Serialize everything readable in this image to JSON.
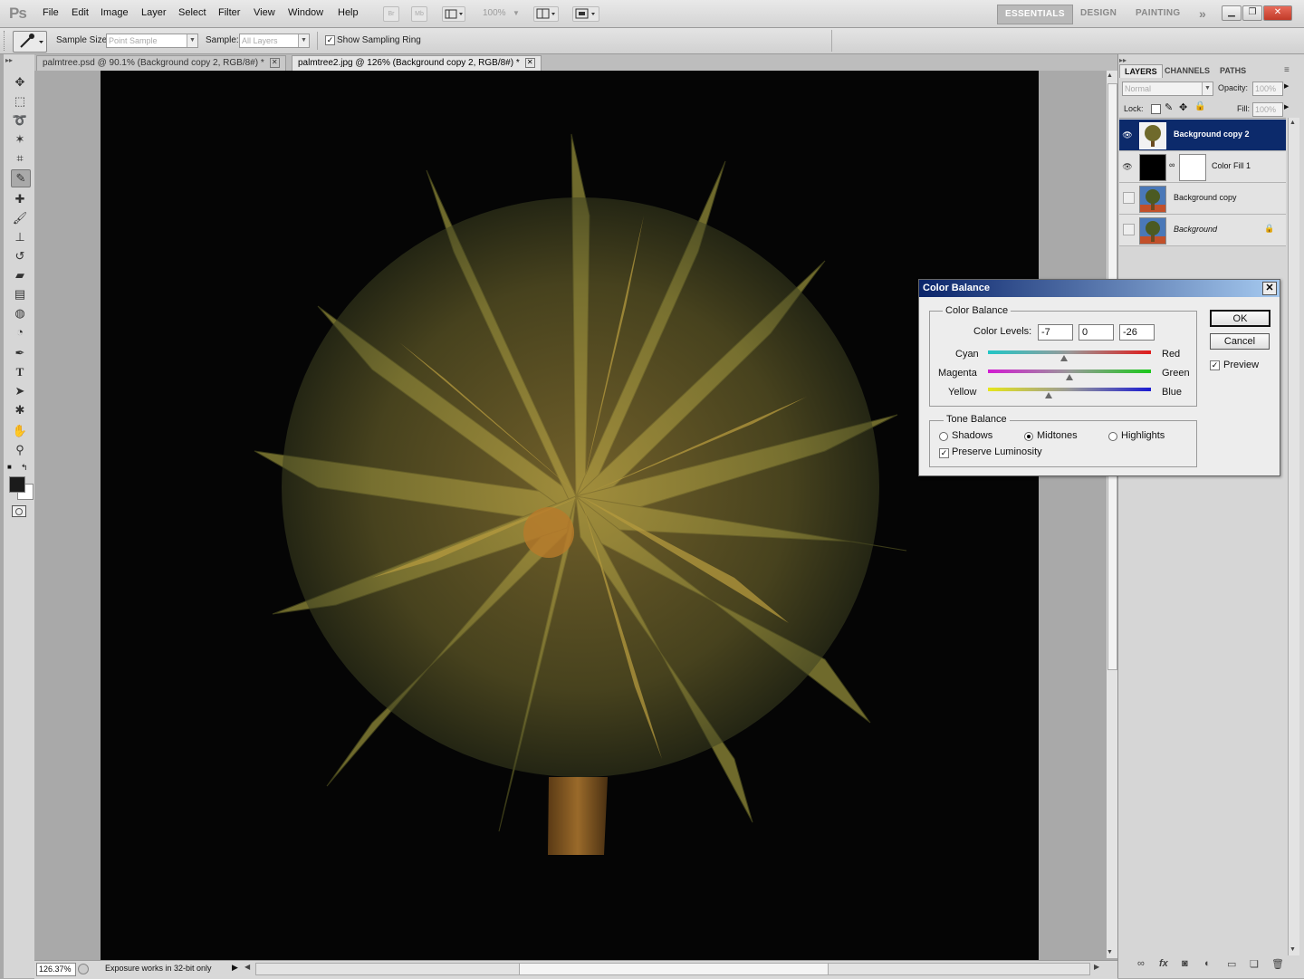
{
  "app": {
    "logo": "Ps"
  },
  "menu": [
    "File",
    "Edit",
    "Image",
    "Layer",
    "Select",
    "Filter",
    "View",
    "Window",
    "Help"
  ],
  "menubar": {
    "bridge_label": "Br",
    "minibridge_label": "Mb",
    "zoom": "100%"
  },
  "workspaces": {
    "essentials": "ESSENTIALS",
    "design": "DESIGN",
    "painting": "PAINTING",
    "more": "»"
  },
  "options": {
    "sample_size_label": "Sample Size:",
    "sample_size_value": "Point Sample",
    "sample_label": "Sample:",
    "sample_value": "All Layers",
    "show_ring_label": "Show Sampling Ring"
  },
  "tabs": [
    {
      "label": "palmtree.psd @ 90.1% (Background copy 2, RGB/8#) *"
    },
    {
      "label": "palmtree2.jpg @ 126% (Background copy 2, RGB/8#) *"
    }
  ],
  "status": {
    "zoom": "126.37%",
    "message": "Exposure works in 32-bit only"
  },
  "panels": {
    "tabs": [
      "LAYERS",
      "CHANNELS",
      "PATHS"
    ],
    "blend_mode": "Normal",
    "opacity_label": "Opacity:",
    "opacity_value": "100%",
    "lock_label": "Lock:",
    "fill_label": "Fill:",
    "fill_value": "100%",
    "layers": [
      {
        "name": "Background copy 2",
        "visible": true,
        "selected": true
      },
      {
        "name": "Color Fill 1",
        "visible": true,
        "selected": false
      },
      {
        "name": "Background copy",
        "visible": false,
        "selected": false
      },
      {
        "name": "Background",
        "visible": false,
        "selected": false,
        "locked": true
      }
    ]
  },
  "dialog": {
    "title": "Color Balance",
    "group_label": "Color Balance",
    "levels_label": "Color Levels:",
    "levels": [
      "-7",
      "0",
      "-26"
    ],
    "sliders": [
      {
        "left": "Cyan",
        "right": "Red",
        "value": -7,
        "from": "#22c6c6",
        "to": "#e01b1b"
      },
      {
        "left": "Magenta",
        "right": "Green",
        "value": 0,
        "from": "#d21bd2",
        "to": "#1bc81b"
      },
      {
        "left": "Yellow",
        "right": "Blue",
        "value": -26,
        "from": "#e6e61b",
        "to": "#1b1bd2"
      }
    ],
    "tone_label": "Tone Balance",
    "tones": {
      "shadows": "Shadows",
      "midtones": "Midtones",
      "highlights": "Highlights"
    },
    "selected_tone": "Midtones",
    "preserve_label": "Preserve Luminosity",
    "ok_label": "OK",
    "cancel_label": "Cancel",
    "preview_label": "Preview"
  }
}
